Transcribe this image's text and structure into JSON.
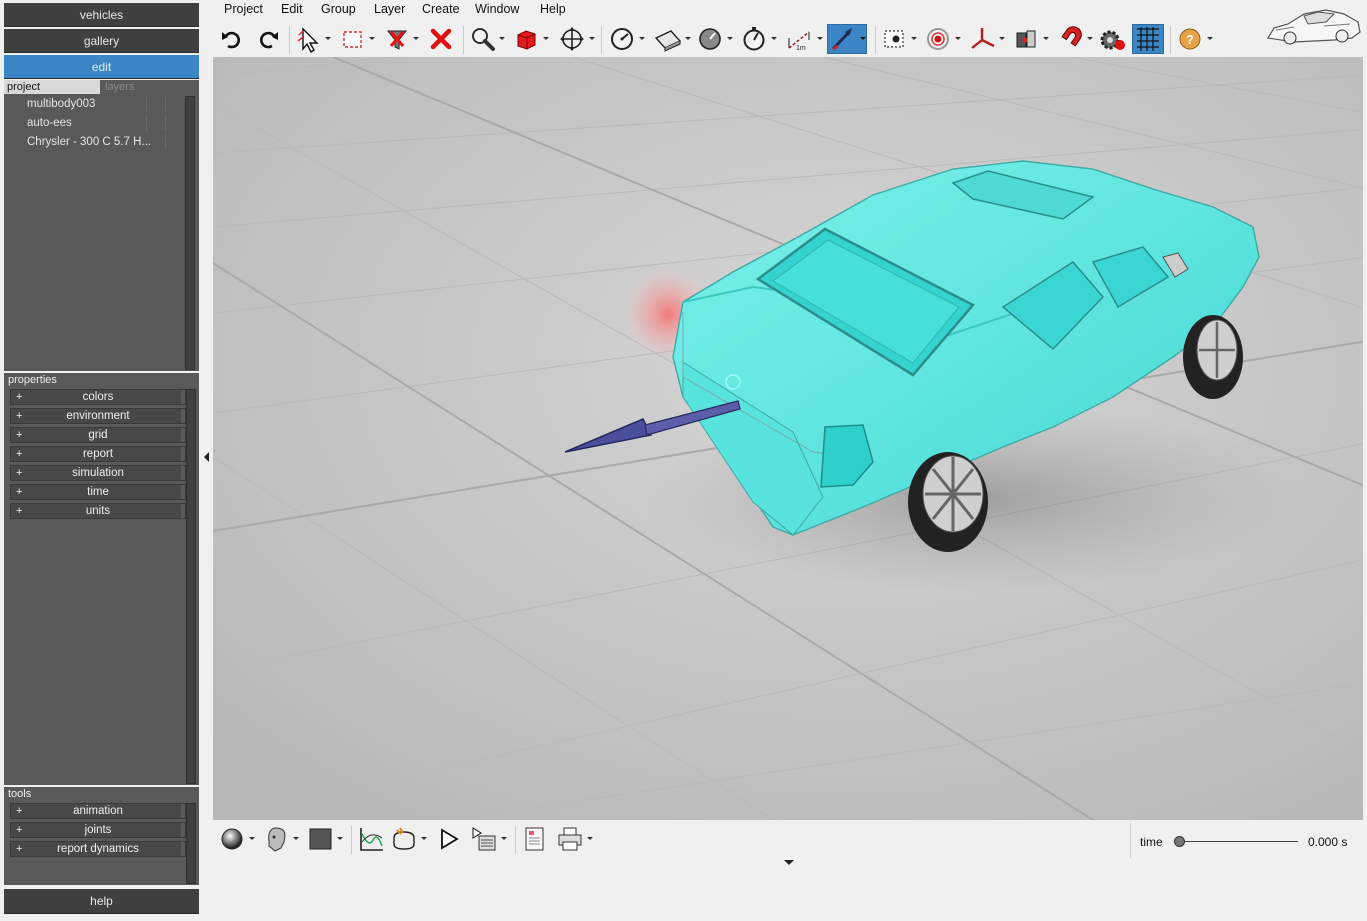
{
  "left_panel": {
    "nav": {
      "vehicles": "vehicles",
      "gallery": "gallery",
      "edit": "edit",
      "help": "help"
    },
    "project_panel": {
      "tab_project": "project",
      "tab_layers": "layers",
      "items": [
        "multibody003",
        "auto-ees",
        "Chrysler - 300 C 5.7 H..."
      ]
    },
    "properties_panel": {
      "title": "properties",
      "items": [
        "colors",
        "environment",
        "grid",
        "report",
        "simulation",
        "time",
        "units"
      ]
    },
    "tools_panel": {
      "title": "tools",
      "items": [
        "animation",
        "joints",
        "report dynamics"
      ]
    },
    "plus_glyph": "+"
  },
  "menu": {
    "items": [
      "Project",
      "Edit",
      "Group",
      "Layer",
      "Create",
      "Window",
      "Help"
    ]
  },
  "toolbar": {
    "icons": [
      "undo-icon",
      "redo-icon",
      "select-arrow-icon",
      "select-rect-icon",
      "filter-delete-icon",
      "delete-icon",
      "zoom-icon",
      "body-cube-icon",
      "move-icon",
      "clock-icon",
      "plane-icon",
      "gauge-icon",
      "stopwatch-icon",
      "measure-icon",
      "force-vector-icon",
      "snap-point-icon",
      "target-icon",
      "axes-icon",
      "joint-icon",
      "magnet-icon",
      "settings-record-icon",
      "grid-icon",
      "help-icon"
    ],
    "measure_label": "1m"
  },
  "bottom_toolbar": {
    "icons": [
      "render-sphere-icon",
      "head-view-icon",
      "color-square-icon",
      "graph-icon",
      "camera-icon",
      "play-icon",
      "render-list-icon",
      "report-icon",
      "print-icon"
    ],
    "time_label": "time",
    "time_value": "0.000 s",
    "time_fraction": 0
  },
  "colors": {
    "accent": "#3d86c6",
    "panel_dark": "#595959",
    "nav_dark": "#404040",
    "car_body": "#5ee6e0",
    "force_arrow": "#4b4e9a",
    "floor": "#c9c9c9"
  }
}
